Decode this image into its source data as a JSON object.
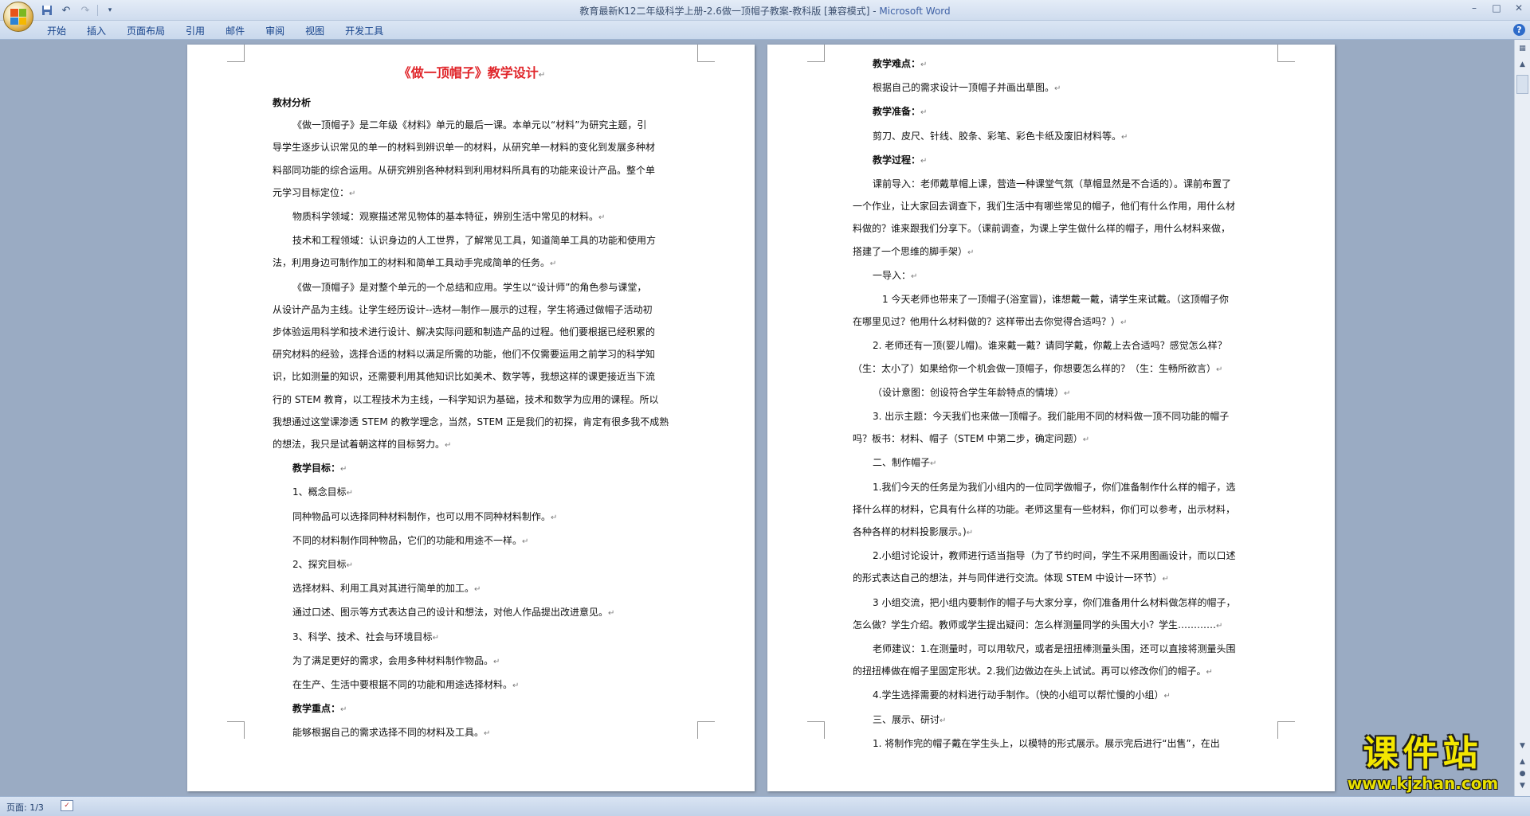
{
  "window": {
    "doc_name": "教育最新K12二年级科学上册-2.6做一顶帽子教案-教科版 [兼容模式]",
    "separator": " - ",
    "app_name": "Microsoft Word"
  },
  "quick_access": {
    "save_icon": "save-icon",
    "undo_icon": "undo-icon",
    "redo_icon": "redo-icon",
    "customize_icon": "dropdown-icon"
  },
  "ribbon": {
    "tabs": [
      "开始",
      "插入",
      "页面布局",
      "引用",
      "邮件",
      "审阅",
      "视图",
      "开发工具"
    ]
  },
  "colors": {
    "title_red": "#e0252a",
    "watermark_yellow": "#f3e600",
    "page_bg": "#ffffff",
    "workspace_bg": "#9aabc3"
  },
  "page1": {
    "title": "《做一顶帽子》教学设计",
    "lines": [
      {
        "t": "教材分析",
        "b": true
      },
      {
        "t": "《做一顶帽子》是二年级《材料》单元的最后一课。本单元以“材料”为研究主题，引",
        "i": true
      },
      {
        "t": "导学生逐步认识常见的单一的材料到辨识单一的材料，从研究单一材料的变化到发展多种材"
      },
      {
        "t": "料部同功能的综合运用。从研究辨别各种材料到利用材料所具有的功能来设计产品。整个单"
      },
      {
        "t": "元学习目标定位：",
        "m": true
      },
      {
        "t": "物质科学领域：观察描述常见物体的基本特征，辨别生活中常见的材料。",
        "i": true,
        "m": true
      },
      {
        "t": "技术和工程领域：认识身边的人工世界，了解常见工具，知道简单工具的功能和使用方",
        "i": true
      },
      {
        "t": "法，利用身边可制作加工的材料和简单工具动手完成简单的任务。",
        "m": true
      },
      {
        "t": "《做一顶帽子》是对整个单元的一个总结和应用。学生以“设计师”的角色参与课堂，",
        "i": true
      },
      {
        "t": "从设计产品为主线。让学生经历设计--选材—制作—展示的过程，学生将通过做帽子活动初"
      },
      {
        "t": "步体验运用科学和技术进行设计、解决实际问题和制造产品的过程。他们要根据已经积累的"
      },
      {
        "t": "研究材料的经验，选择合适的材料以满足所需的功能，他们不仅需要运用之前学习的科学知"
      },
      {
        "t": "识，比如测量的知识，还需要利用其他知识比如美术、数学等，我想这样的课更接近当下流"
      },
      {
        "t": "行的 STEM 教育，以工程技术为主线，一科学知识为基础，技术和数学为应用的课程。所以"
      },
      {
        "t": "我想通过这堂课渗透 STEM 的教学理念，当然，STEM 正是我们的初探，肯定有很多我不成熟"
      },
      {
        "t": "的想法，我只是试着朝这样的目标努力。",
        "m": true
      },
      {
        "t": "教学目标：",
        "b": true,
        "i": true,
        "m": true
      },
      {
        "t": "1、概念目标",
        "i": true,
        "m": true
      },
      {
        "t": "同种物品可以选择同种材料制作，也可以用不同种材料制作。",
        "i": true,
        "m": true
      },
      {
        "t": "不同的材料制作同种物品，它们的功能和用途不一样。",
        "i": true,
        "m": true
      },
      {
        "t": "2、探究目标",
        "i": true,
        "m": true
      },
      {
        "t": "选择材料、利用工具对其进行简单的加工。",
        "i": true,
        "m": true
      },
      {
        "t": "通过口述、图示等方式表达自己的设计和想法，对他人作品提出改进意见。",
        "i": true,
        "m": true
      },
      {
        "t": "3、科学、技术、社会与环境目标",
        "i": true,
        "m": true
      },
      {
        "t": "为了满足更好的需求，会用多种材料制作物品。",
        "i": true,
        "m": true
      },
      {
        "t": "在生产、生活中要根据不同的功能和用途选择材料。",
        "i": true,
        "m": true
      },
      {
        "t": "教学重点：",
        "b": true,
        "i": true,
        "m": true
      },
      {
        "t": "能够根据自己的需求选择不同的材料及工具。",
        "i": true,
        "m": true
      }
    ]
  },
  "page2": {
    "lines": [
      {
        "t": "教学难点：",
        "b": true,
        "i": true,
        "m": true
      },
      {
        "t": "根据自己的需求设计一顶帽子并画出草图。",
        "i": true,
        "m": true
      },
      {
        "t": "教学准备：",
        "b": true,
        "i": true,
        "m": true
      },
      {
        "t": "剪刀、皮尺、针线、胶条、彩笔、彩色卡纸及废旧材料等。",
        "i": true,
        "m": true
      },
      {
        "t": "教学过程：",
        "b": true,
        "i": true,
        "m": true
      },
      {
        "t": "课前导入：老师戴草帽上课，营造一种课堂气氛（草帽显然是不合适的）。课前布置了",
        "i": true
      },
      {
        "t": "一个作业，让大家回去调查下，我们生活中有哪些常见的帽子，他们有什么作用，用什么材"
      },
      {
        "t": "料做的？谁来跟我们分享下。（课前调查，为课上学生做什么样的帽子，用什么材料来做，"
      },
      {
        "t": "搭建了一个思维的脚手架）",
        "m": true
      },
      {
        "t": "一导入：",
        "i": true,
        "m": true
      },
      {
        "t": "1 今天老师也带来了一顶帽子(浴室冒)，谁想戴一戴，请学生来试戴。（这顶帽子你",
        "i2": true
      },
      {
        "t": "在哪里见过？他用什么材料做的？这样带出去你觉得合适吗？）",
        "m": true
      },
      {
        "t": "2.    老师还有一顶(婴儿帽)。谁来戴一戴？请同学戴，你戴上去合适吗？感觉怎么样？",
        "i": true
      },
      {
        "t": "（生：太小了）如果给你一个机会做一顶帽子，你想要怎么样的？（生：生畅所欲言）",
        "m": true
      },
      {
        "t": "（设计意图：创设符合学生年龄特点的情境）",
        "i": true,
        "m": true
      },
      {
        "t": "3.    出示主题：今天我们也来做一顶帽子。我们能用不同的材料做一顶不同功能的帽子",
        "i": true
      },
      {
        "t": "吗？板书：材料、帽子（STEM 中第二步，确定问题）",
        "m": true
      },
      {
        "t": "二、制作帽子",
        "i": true,
        "m": true
      },
      {
        "t": "1.我们今天的任务是为我们小组内的一位同学做帽子，你们准备制作什么样的帽子，选",
        "i": true
      },
      {
        "t": "择什么样的材料，它具有什么样的功能。老师这里有一些材料，你们可以参考，出示材料，"
      },
      {
        "t": "各种各样的材料投影展示。)",
        "m": true
      },
      {
        "t": "2.小组讨论设计，教师进行适当指导（为了节约时间，学生不采用图画设计，而以口述",
        "i": true
      },
      {
        "t": "的形式表达自己的想法，并与同伴进行交流。体现 STEM 中设计一环节）",
        "m": true
      },
      {
        "t": "3 小组交流，把小组内要制作的帽子与大家分享，你们准备用什么材料做怎样的帽子，",
        "i": true
      },
      {
        "t": "怎么做？学生介绍。教师或学生提出疑问：怎么样测量同学的头围大小？学生…………",
        "m": true
      },
      {
        "t": "老师建议：1.在测量时，可以用软尺，或者是扭扭棒测量头围，还可以直接将测量头围",
        "i": true
      },
      {
        "t": "的扭扭棒做在帽子里固定形状。2.我们边做边在头上试试。再可以修改你们的帽子。",
        "m": true
      },
      {
        "t": "4.学生选择需要的材料进行动手制作。（快的小组可以帮忙慢的小组）",
        "i": true,
        "m": true
      },
      {
        "t": "三、展示、研讨",
        "i": true,
        "m": true
      },
      {
        "t": "1.    将制作完的帽子戴在学生头上，以模特的形式展示。展示完后进行“出售”，在出",
        "i": true
      }
    ]
  },
  "status": {
    "page_count": "页面: 1/3"
  },
  "watermark": {
    "title": "课件站",
    "url": "www.kjzhan.com"
  }
}
